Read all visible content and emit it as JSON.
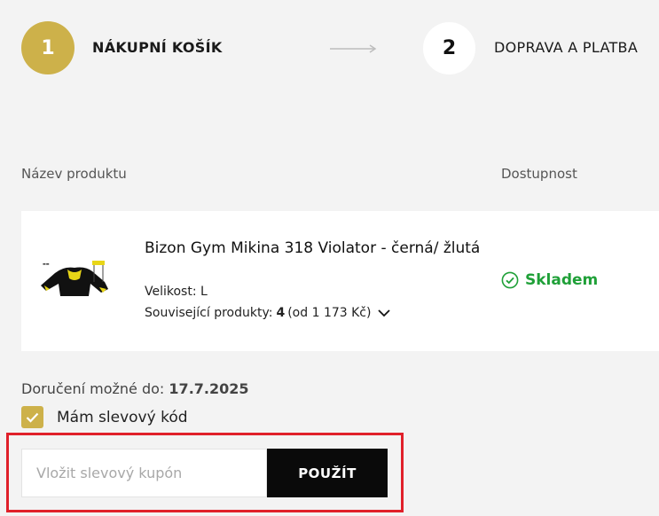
{
  "steps": [
    {
      "number": "1",
      "label": "NÁKUPNÍ KOŠÍK"
    },
    {
      "number": "2",
      "label": "DOPRAVA A PLATBA"
    }
  ],
  "table": {
    "col_product": "Název produktu",
    "col_availability": "Dostupnost"
  },
  "product": {
    "title": "Bizon Gym Mikina 318 Violator - černá/ žlutá",
    "size_text": "Velikost: L",
    "related_label": "Související produkty:",
    "related_count": "4",
    "related_price": "(od 1 173 Kč)",
    "stock_label": "Skladem",
    "thumb_icon": "hoodie-image"
  },
  "delivery": {
    "label": "Doručení možné do:",
    "date": "17.7.2025"
  },
  "discount": {
    "checkbox_label": "Mám slevový kód",
    "checked": true,
    "input_placeholder": "Vložit slevový kupón",
    "input_value": "",
    "apply_label": "POUŽÍT"
  },
  "colors": {
    "accent_gold": "#cdb14a",
    "stock_green": "#1fa038",
    "highlight_red": "#e0202a"
  }
}
